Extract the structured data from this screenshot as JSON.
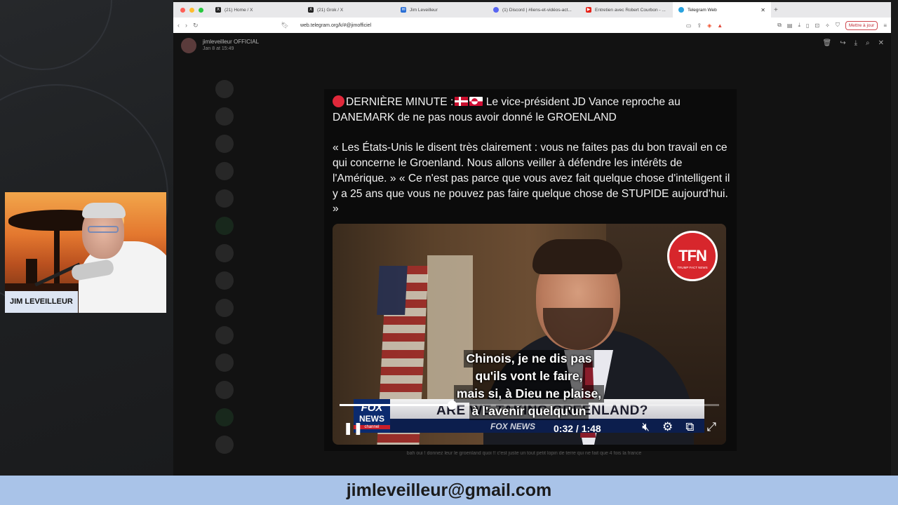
{
  "browser": {
    "tabs": [
      {
        "label": "(21) Home / X",
        "icon": "x-logo-icon",
        "color": "#222222",
        "active": false
      },
      {
        "label": "(21) Grok / X",
        "icon": "x-logo-icon",
        "color": "#222222",
        "active": false
      },
      {
        "label": "Jim Leveilleur",
        "icon": "mail-icon",
        "color": "#2a6fd6",
        "active": false
      },
      {
        "label": "(1) Discord | #liens-et-vidéos-act...",
        "icon": "discord-icon",
        "color": "#5865f2",
        "active": false
      },
      {
        "label": "Entretien avec Robert Courbon - ...",
        "icon": "youtube-icon",
        "color": "#e62117",
        "active": false
      },
      {
        "label": "Telegram Web",
        "icon": "telegram-icon",
        "color": "#2aa3df",
        "active": true
      }
    ],
    "url": "web.telegram.org/k/#@jimofficiel",
    "update_button": "Mettre à jour"
  },
  "telegram": {
    "channel_name": "jimleveilleur OFFICIAL",
    "post_date": "Jan 8 at 15:49",
    "post": {
      "line1_prefix": "DERNIÈRE MINUTE :",
      "line1_suffix": " Le vice-président JD Vance reproche au DANEMARK de ne pas nous avoir donné le GROENLAND",
      "quote": "« Les États-Unis le disent très clairement : vous ne faites pas du bon travail en ce qui concerne le Groenland. Nous allons veiller à défendre les intérêts de l'Amérique. »  « Ce n'est pas parce que vous avez fait quelque chose d'intelligent il y a 25 ans que vous ne pouvez pas faire quelque chose de STUPIDE aujourd'hui. »"
    },
    "video": {
      "logo_big": "TFN",
      "logo_small": "TRUMP FACT NEWS",
      "banner_headline": "ARE WE TAKING GREENLAND?",
      "fox_logo_top": "FOX",
      "fox_logo_mid": "NEWS",
      "fox_logo_bottom": "channel",
      "lower_third": "FOX NEWS",
      "subtitle_lines": [
        "Chinois, je ne dis pas",
        "qu'ils vont le faire,",
        "mais si, à Dieu ne plaise,",
        "à l'avenir quelqu'un"
      ],
      "time": "0:32 / 1:48",
      "progress": 0.296
    },
    "next_post_text": "bah oui ! donnez leur le groenland quoi !! c'est juste un tout petit lopin de terre qui ne fait que 4 fois la france"
  },
  "stream": {
    "host_label": "JIM LEVEILLEUR",
    "email": "jimleveilleur@gmail.com"
  }
}
